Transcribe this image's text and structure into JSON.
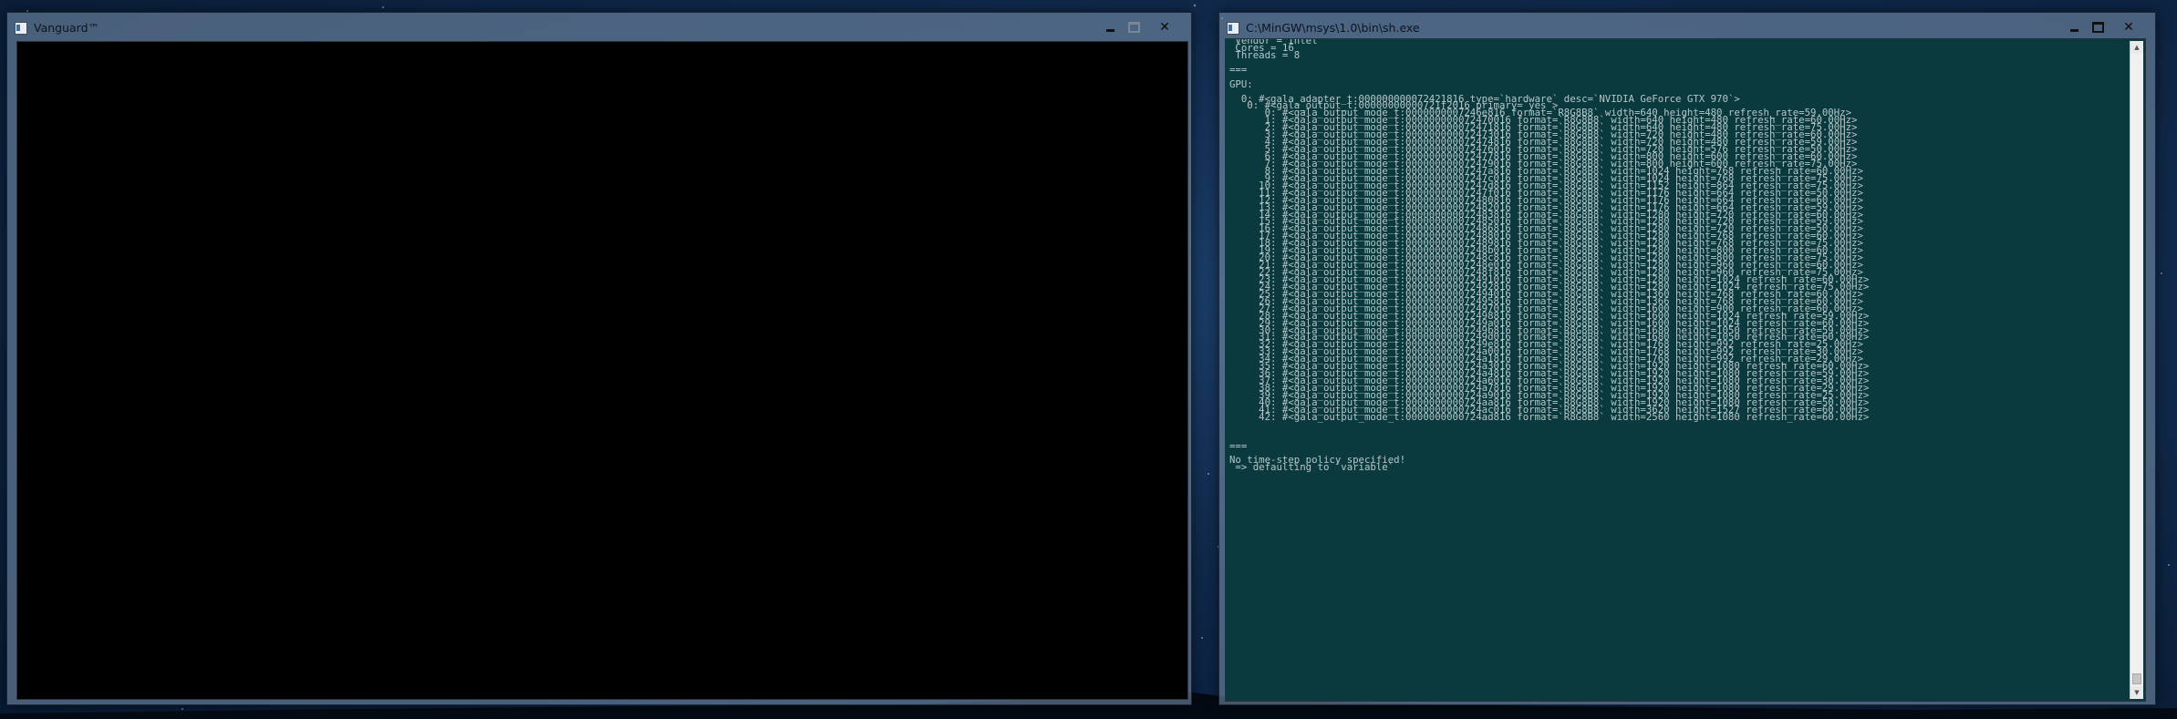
{
  "desktop": {
    "background": "#102a4c"
  },
  "vanguard_window": {
    "title": "Vanguard™",
    "client_color": "#000000"
  },
  "console_window": {
    "title": "C:\\MinGW\\msys\\1.0\\bin\\sh.exe",
    "background": "#0b3a3e",
    "text_color": "#b7c6c8",
    "lines": [
      " Vendor = Intel",
      " Cores = 16",
      " Threads = 8",
      "",
      "===",
      "",
      "GPU:",
      "",
      "  0: #<gala_adapter_t:000000000072421816 type=`hardware` desc=`NVIDIA GeForce GTX 970`>",
      "   0: #<gala_output_t:00000000000721f2016 primary=`yes`>",
      "      0: #<gala_output_mode_t:0000000007246e816 format=`R8G8B8` width=640 height=480 refresh_rate=59.00Hz>",
      "      1: #<gala_output_mode_t:000000000072470016 format=`R8G8B8` width=640 height=480 refresh_rate=60.00Hz>",
      "      2: #<gala_output_mode_t:000000000072471816 format=`R8G8B8` width=640 height=480 refresh_rate=75.00Hz>",
      "      3: #<gala_output_mode_t:000000000072473016 format=`R8G8B8` width=720 height=480 refresh_rate=60.00Hz>",
      "      4: #<gala_output_mode_t:000000000072474816 format=`R8G8B8` width=720 height=480 refresh_rate=59.00Hz>",
      "      5: #<gala_output_mode_t:000000000072476016 format=`R8G8B8` width=720 height=576 refresh_rate=50.00Hz>",
      "      6: #<gala_output_mode_t:000000000072477816 format=`R8G8B8` width=800 height=600 refresh_rate=60.00Hz>",
      "      7: #<gala_output_mode_t:000000000072479016 format=`R8G8B8` width=800 height=600 refresh_rate=75.00Hz>",
      "      8: #<gala_output_mode_t:00000000007247a816 format=`R8G8B8` width=1024 height=768 refresh_rate=60.00Hz>",
      "      9: #<gala_output_mode_t:00000000007247c016 format=`R8G8B8` width=1024 height=768 refresh_rate=75.00Hz>",
      "     10: #<gala_output_mode_t:00000000007247d816 format=`R8G8B8` width=1152 height=864 refresh_rate=75.00Hz>",
      "     11: #<gala_output_mode_t:00000000007247f016 format=`R8G8B8` width=1176 height=664 refresh_rate=50.00Hz>",
      "     12: #<gala_output_mode_t:000000000072480816 format=`R8G8B8` width=1176 height=664 refresh_rate=60.00Hz>",
      "     13: #<gala_output_mode_t:000000000072482016 format=`R8G8B8` width=1176 height=664 refresh_rate=59.00Hz>",
      "     14: #<gala_output_mode_t:000000000072483816 format=`R8G8B8` width=1280 height=720 refresh_rate=60.00Hz>",
      "     15: #<gala_output_mode_t:000000000072485016 format=`R8G8B8` width=1280 height=720 refresh_rate=59.00Hz>",
      "     16: #<gala_output_mode_t:000000000072486816 format=`R8G8B8` width=1280 height=720 refresh_rate=50.00Hz>",
      "     17: #<gala_output_mode_t:000000000072488016 format=`R8G8B8` width=1280 height=768 refresh_rate=60.00Hz>",
      "     18: #<gala_output_mode_t:000000000072489816 format=`R8G8B8` width=1280 height=768 refresh_rate=75.00Hz>",
      "     19: #<gala_output_mode_t:00000000007248b016 format=`R8G8B8` width=1280 height=800 refresh_rate=60.00Hz>",
      "     20: #<gala_output_mode_t:00000000007248c816 format=`R8G8B8` width=1280 height=800 refresh_rate=75.00Hz>",
      "     21: #<gala_output_mode_t:00000000007248e016 format=`R8G8B8` width=1280 height=960 refresh_rate=60.00Hz>",
      "     22: #<gala_output_mode_t:00000000007248f816 format=`R8G8B8` width=1280 height=960 refresh_rate=75.00Hz>",
      "     23: #<gala_output_mode_t:000000000072491016 format=`R8G8B8` width=1280 height=1024 refresh_rate=60.00Hz>",
      "     24: #<gala_output_mode_t:000000000072492816 format=`R8G8B8` width=1280 height=1024 refresh_rate=75.00Hz>",
      "     25: #<gala_output_mode_t:000000000072494016 format=`R8G8B8` width=1360 height=768 refresh_rate=60.00Hz>",
      "     26: #<gala_output_mode_t:000000000072495816 format=`R8G8B8` width=1366 height=768 refresh_rate=60.00Hz>",
      "     27: #<gala_output_mode_t:000000000072497016 format=`R8G8B8` width=1600 height=900 refresh_rate=60.00Hz>",
      "     28: #<gala_output_mode_t:000000000072498816 format=`R8G8B8` width=1600 height=1024 refresh_rate=59.00Hz>",
      "     29: #<gala_output_mode_t:00000000007249a016 format=`R8G8B8` width=1600 height=1024 refresh_rate=60.00Hz>",
      "     30: #<gala_output_mode_t:00000000007249b816 format=`R8G8B8` width=1680 height=1050 refresh_rate=59.00Hz>",
      "     31: #<gala_output_mode_t:00000000007249d016 format=`R8G8B8` width=1680 height=1050 refresh_rate=60.00Hz>",
      "     32: #<gala_output_mode_t:00000000007249e816 format=`R8G8B8` width=1768 height=992 refresh_rate=25.00Hz>",
      "     33: #<gala_output_mode_t:0000000000724a0016 format=`R8G8B8` width=1768 height=992 refresh_rate=30.00Hz>",
      "     34: #<gala_output_mode_t:0000000000724a1816 format=`R8G8B8` width=1768 height=992 refresh_rate=29.00Hz>",
      "     35: #<gala_output_mode_t:0000000000724a3016 format=`R8G8B8` width=1920 height=1080 refresh_rate=60.00Hz>",
      "     36: #<gala_output_mode_t:0000000000724a4816 format=`R8G8B8` width=1920 height=1080 refresh_rate=59.00Hz>",
      "     37: #<gala_output_mode_t:0000000000724a6016 format=`R8G8B8` width=1920 height=1080 refresh_rate=30.00Hz>",
      "     38: #<gala_output_mode_t:0000000000724a7816 format=`R8G8B8` width=1920 height=1080 refresh_rate=29.00Hz>",
      "     39: #<gala_output_mode_t:0000000000724a9016 format=`R8G8B8` width=1920 height=1080 refresh_rate=25.00Hz>",
      "     40: #<gala_output_mode_t:0000000000724aa816 format=`R8G8B8` width=1920 height=1080 refresh_rate=50.00Hz>",
      "     41: #<gala_output_mode_t:0000000000724ac016 format=`R8G8B8` width=3620 height=1527 refresh_rate=60.00Hz>",
      "     42: #<gala_output_mode_t:0000000000724ad816 format=`R8G8B8` width=2560 height=1080 refresh_rate=60.00Hz>",
      "",
      "",
      "",
      "===",
      "",
      "No time-step policy specified!",
      " => defaulting to `variable`"
    ]
  },
  "window_controls": {
    "minimize_icon": "minimize-icon",
    "maximize_icon": "maximize-icon",
    "close_icon": "close-icon",
    "close_glyph": "✕"
  }
}
